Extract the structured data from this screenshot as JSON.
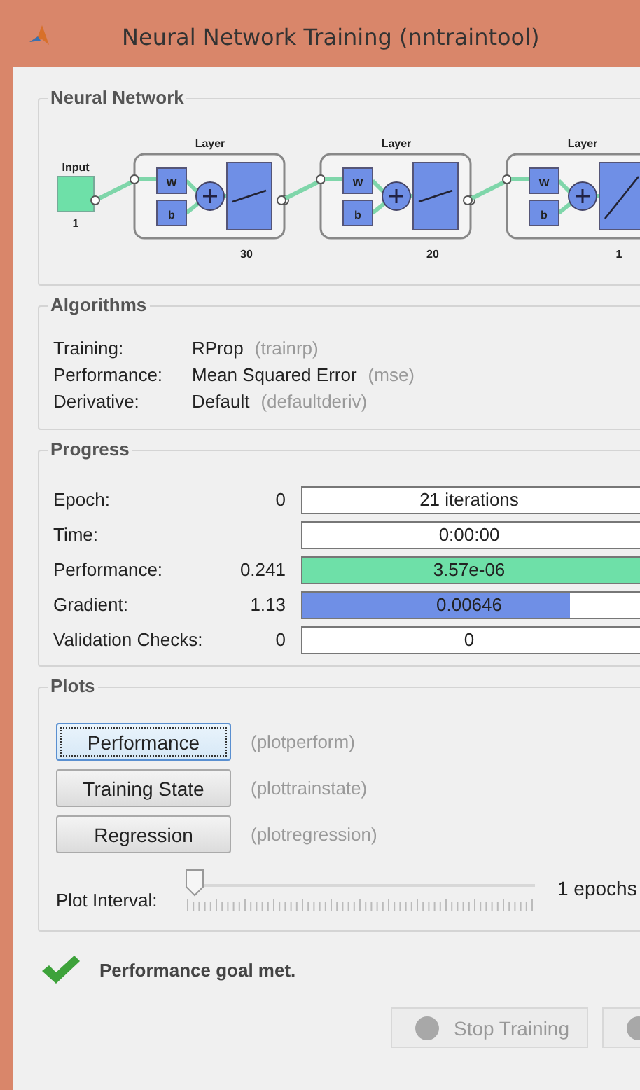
{
  "window": {
    "title": "Neural Network Training (nntraintool)"
  },
  "network": {
    "title": "Neural Network",
    "input": {
      "label": "Input",
      "size": "1"
    },
    "layers": [
      {
        "label": "Layer",
        "weight": "W",
        "bias": "b",
        "size": "30"
      },
      {
        "label": "Layer",
        "weight": "W",
        "bias": "b",
        "size": "20"
      },
      {
        "label": "Layer",
        "weight": "W",
        "bias": "b",
        "size": "1"
      }
    ]
  },
  "algorithms": {
    "title": "Algorithms",
    "rows": [
      {
        "label": "Training:",
        "value": "RProp",
        "function": "(trainrp)"
      },
      {
        "label": "Performance:",
        "value": "Mean Squared Error",
        "function": "(mse)"
      },
      {
        "label": "Derivative:",
        "value": "Default",
        "function": "(defaultderiv)"
      }
    ]
  },
  "progress": {
    "title": "Progress",
    "rows": [
      {
        "label": "Epoch:",
        "start": "0",
        "bar_text": "21 iterations"
      },
      {
        "label": "Time:",
        "bar_text": "0:00:00"
      },
      {
        "label": "Performance:",
        "start": "0.241",
        "bar_text": "3.57e-06",
        "level": 1,
        "color": "#6ee0a8"
      },
      {
        "label": "Gradient:",
        "start": "1.13",
        "bar_text": "0.00646",
        "level": 0.77,
        "color": "#6f8fe6"
      },
      {
        "label": "Validation Checks:",
        "start": "0",
        "bar_text": "0"
      }
    ]
  },
  "plots": {
    "title": "Plots",
    "buttons": [
      {
        "label": "Performance",
        "function": "(plotperform)",
        "focused": true
      },
      {
        "label": "Training State",
        "function": "(plottrainstate)",
        "focused": false
      },
      {
        "label": "Regression",
        "function": "(plotregression)",
        "focused": false
      }
    ],
    "interval": {
      "label": "Plot Interval:",
      "level": 0,
      "reading": "1 epochs"
    }
  },
  "status": {
    "message": "Performance goal met."
  },
  "buttons": [
    {
      "label": "Stop Training",
      "disabled": true
    },
    {
      "disabled": true
    }
  ]
}
